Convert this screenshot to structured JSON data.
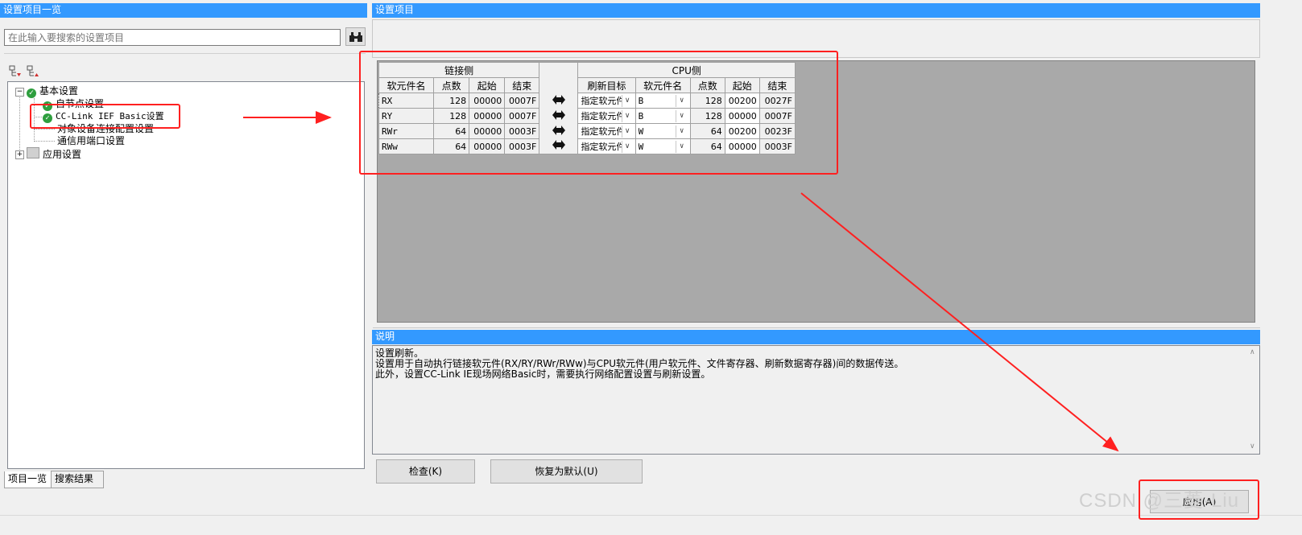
{
  "left_panel": {
    "title": "设置项目一览",
    "search_placeholder": "在此输入要搜索的设置项目",
    "tree": {
      "root_basic": "基本设置",
      "own_node": "自节点设置",
      "cclink": "CC-Link IEF Basic设置",
      "target_device": "对象设备连接配置设置",
      "comm_port": "通信用端口设置",
      "root_app": "应用设置"
    },
    "tabs": [
      "项目一览",
      "搜索结果"
    ]
  },
  "settings_panel": {
    "title": "设置项目",
    "link_side_header": "链接侧",
    "cpu_side_header": "CPU侧",
    "columns_link": [
      "软元件名",
      "点数",
      "起始",
      "结束"
    ],
    "columns_cpu": [
      "刷新目标",
      "软元件名",
      "点数",
      "起始",
      "结束"
    ],
    "rows": [
      {
        "name": "RX",
        "points": "128",
        "start": "00000",
        "end": "0007F",
        "target": "指定软元件",
        "device": "B",
        "cpu_points": "128",
        "cpu_start": "00200",
        "cpu_end": "0027F"
      },
      {
        "name": "RY",
        "points": "128",
        "start": "00000",
        "end": "0007F",
        "target": "指定软元件",
        "device": "B",
        "cpu_points": "128",
        "cpu_start": "00000",
        "cpu_end": "0007F"
      },
      {
        "name": "RWr",
        "points": "64",
        "start": "00000",
        "end": "0003F",
        "target": "指定软元件",
        "device": "W",
        "cpu_points": "64",
        "cpu_start": "00200",
        "cpu_end": "0023F"
      },
      {
        "name": "RWw",
        "points": "64",
        "start": "00000",
        "end": "0003F",
        "target": "指定软元件",
        "device": "W",
        "cpu_points": "64",
        "cpu_start": "00000",
        "cpu_end": "0003F"
      }
    ]
  },
  "description_panel": {
    "title": "说明",
    "lines": [
      "设置刷新。",
      "设置用于自动执行链接软元件(RX/RY/RWr/RWw)与CPU软元件(用户软元件、文件寄存器、刷新数据寄存器)间的数据传送。",
      "此外，设置CC-Link IE现场网络Basic时，需要执行网络配置设置与刷新设置。"
    ]
  },
  "buttons": {
    "check": "检查(K)",
    "restore_default": "恢复为默认(U)",
    "apply": "应用(A)"
  },
  "watermark": "CSDN @三菱-Liu",
  "colors": {
    "title_bar": "#3399ff",
    "annotation_red": "#ff2020",
    "grid_background": "#a9a9a9"
  }
}
